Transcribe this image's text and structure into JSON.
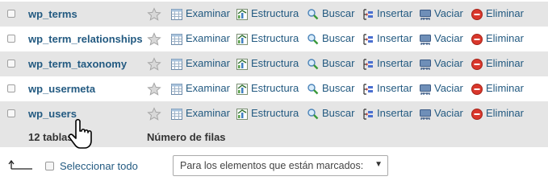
{
  "actions": {
    "browse": "Examinar",
    "structure": "Estructura",
    "search": "Buscar",
    "insert": "Insertar",
    "empty": "Vaciar",
    "drop": "Eliminar"
  },
  "tables": [
    {
      "name": "wp_terms"
    },
    {
      "name": "wp_term_relationships"
    },
    {
      "name": "wp_term_taxonomy"
    },
    {
      "name": "wp_usermeta"
    },
    {
      "name": "wp_users"
    }
  ],
  "footer": {
    "count_label": "12 tablas",
    "rows_label": "Número de filas"
  },
  "bottom": {
    "select_all": "Seleccionar todo",
    "with_selected": "Para los elementos que están marcados:"
  },
  "colors": {
    "link": "#235a81",
    "row_alt": "#e5e5e5",
    "drop_red": "#d9372c"
  }
}
